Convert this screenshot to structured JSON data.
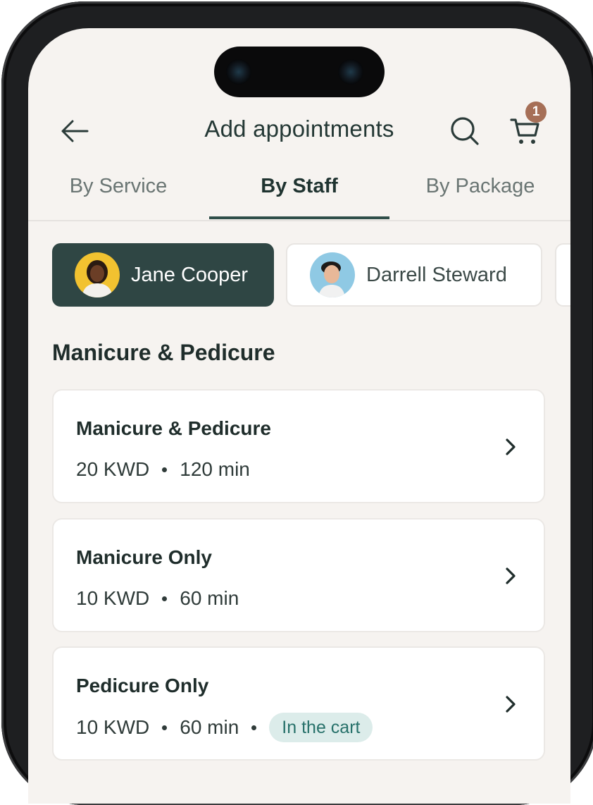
{
  "header": {
    "title": "Add appointments",
    "cart_count": "1"
  },
  "tabs": [
    {
      "label": "By Service",
      "active": false
    },
    {
      "label": "By Staff",
      "active": true
    },
    {
      "label": "By Package",
      "active": false
    }
  ],
  "staff": [
    {
      "name": "Jane Cooper",
      "selected": true
    },
    {
      "name": "Darrell Steward",
      "selected": false
    }
  ],
  "section": {
    "title": "Manicure & Pedicure"
  },
  "services": [
    {
      "name": "Manicure & Pedicure",
      "price": "20 KWD",
      "duration": "120 min"
    },
    {
      "name": "Manicure Only",
      "price": "10 KWD",
      "duration": "60 min"
    },
    {
      "name": "Pedicure Only",
      "price": "10 KWD",
      "duration": "60 min",
      "tag": "In the cart"
    }
  ],
  "colors": {
    "background": "#f6f3f0",
    "accent": "#2f4644",
    "badge": "#a66f57",
    "tag_bg": "#dcecea",
    "tag_text": "#27716a"
  },
  "icons": [
    "back-arrow-icon",
    "search-icon",
    "cart-icon",
    "chevron-right-icon"
  ]
}
